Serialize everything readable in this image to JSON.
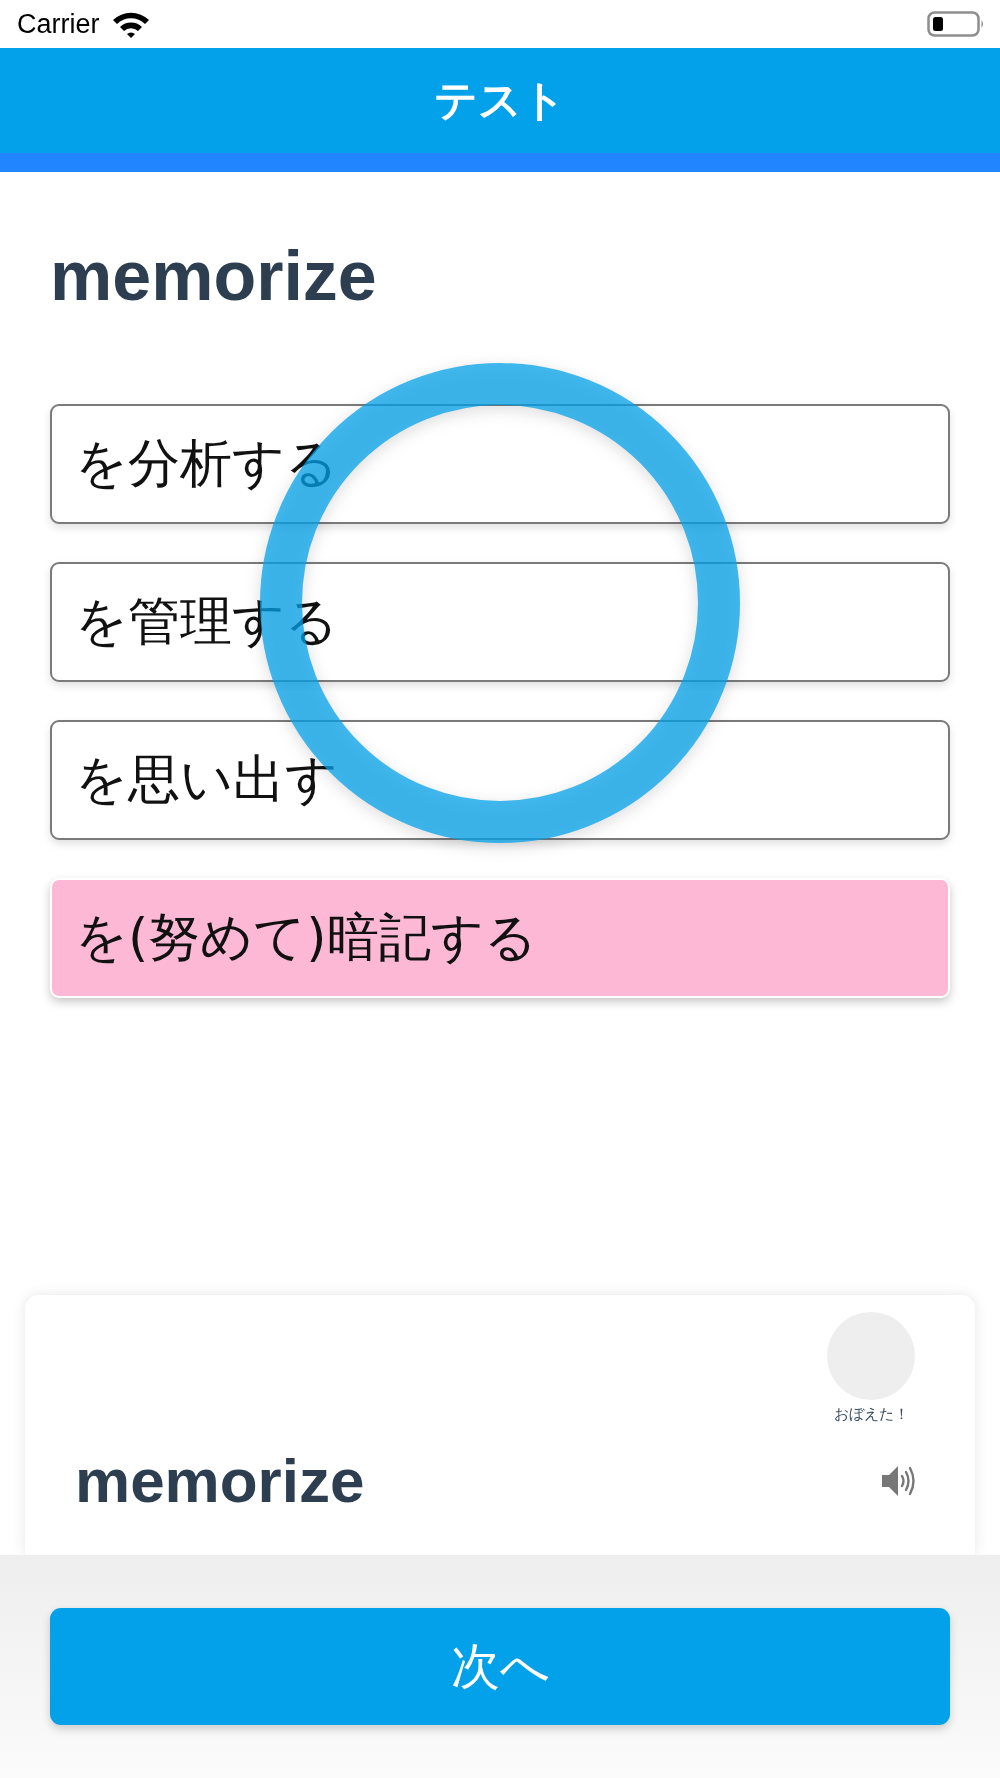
{
  "status_bar": {
    "carrier": "Carrier"
  },
  "header": {
    "title": "テスト"
  },
  "question": {
    "word": "memorize",
    "answered_correctly": true
  },
  "options": [
    {
      "text": "を分析する",
      "correct": false
    },
    {
      "text": "を管理する",
      "correct": false
    },
    {
      "text": "を思い出す",
      "correct": false
    },
    {
      "text": "を(努めて)暗記する",
      "correct": true
    }
  ],
  "card": {
    "memorized": {
      "label": "おぼえた！",
      "checked": false
    },
    "word": "memorize"
  },
  "next_button": {
    "label": "次へ"
  }
}
